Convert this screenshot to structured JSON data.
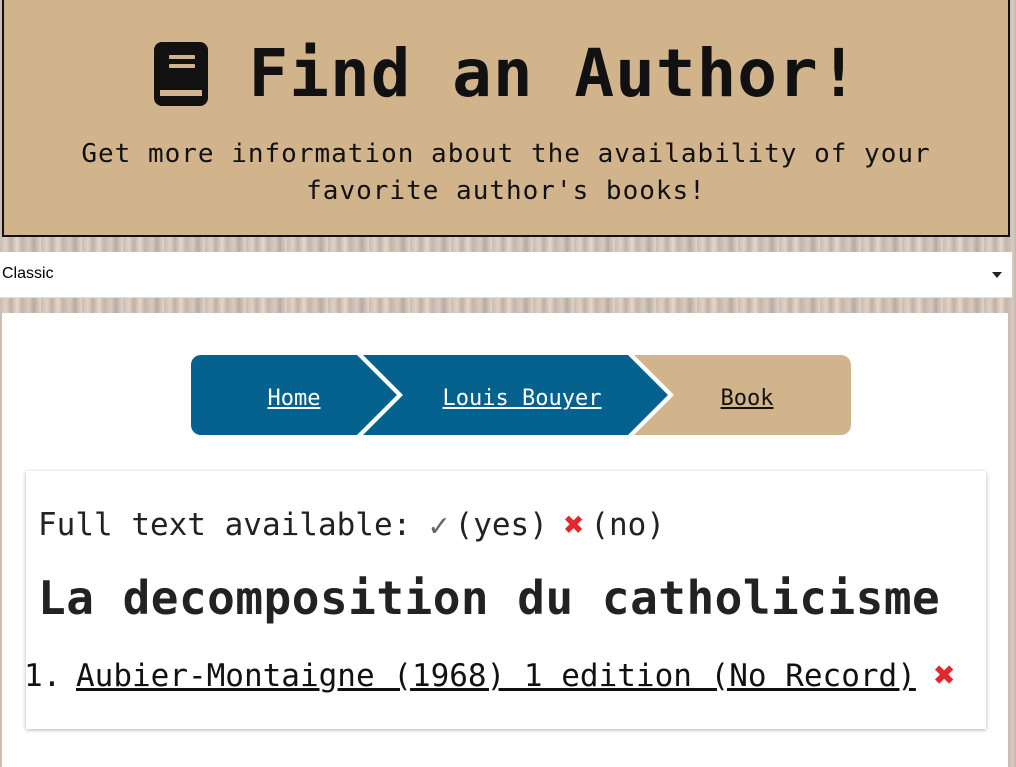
{
  "header": {
    "title": "Find an Author!",
    "subtitle": "Get more information about the availability of your favorite author's books!"
  },
  "select": {
    "value": "Classic"
  },
  "breadcrumb": {
    "items": [
      {
        "label": "Home"
      },
      {
        "label": "Louis Bouyer"
      },
      {
        "label": "Book"
      }
    ],
    "colors": {
      "active": "#05618e",
      "current": "#d2b48c"
    }
  },
  "card": {
    "legend": {
      "prefix": "Full text available:",
      "yes_icon": "✓",
      "yes_label": "(yes)",
      "no_icon": "✖",
      "no_label": "(no)"
    },
    "book_title": "La decomposition du catholicisme",
    "editions": [
      {
        "number": "1.",
        "label": "Aubier-Montaigne (1968) 1 edition (No Record)",
        "icon": "✖"
      }
    ]
  }
}
